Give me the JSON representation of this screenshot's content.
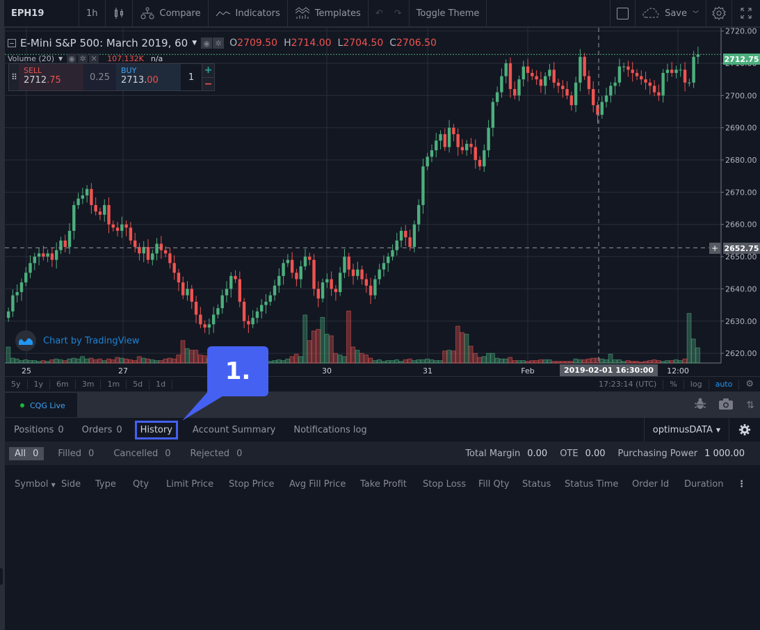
{
  "toolbar": {
    "symbol": "EPH19",
    "interval": "1h",
    "chart_type_icon": "candles-icon",
    "compare_label": "Compare",
    "indicators_label": "Indicators",
    "templates_label": "Templates",
    "toggle_theme_label": "Toggle Theme",
    "save_label": "Save"
  },
  "legend": {
    "title": "E-Mini S&P 500: March 2019, 60",
    "o_label": "O",
    "o_value": "2709.50",
    "h_label": "H",
    "h_value": "2714.00",
    "l_label": "L",
    "l_value": "2704.50",
    "c_label": "C",
    "c_value": "2706.50",
    "volume_label": "Volume (20)",
    "volume_value": "107.132K",
    "volume_ma": "n/a"
  },
  "trade_widget": {
    "sell_label": "SELL",
    "sell_price_main": "2712",
    "sell_price_hi": ".75",
    "spread": "0.25",
    "buy_label": "BUY",
    "buy_price_main": "2713.",
    "buy_price_hi": "00",
    "quantity": "1",
    "plus": "+",
    "minus": "−"
  },
  "watermark": "Chart by TradingView",
  "price_axis": {
    "last_price_tag": "2712.75",
    "crosshair_price_tag": "2652.75",
    "crosshair_time_tag": "2019-02-01 16:30:00"
  },
  "range_bar": {
    "ranges": [
      "5y",
      "1y",
      "6m",
      "3m",
      "1m",
      "5d",
      "1d"
    ],
    "clock": "17:23:14 (UTC)",
    "percent": "%",
    "log": "log",
    "auto": "auto"
  },
  "colors": {
    "up": "#4caf7d",
    "down": "#ef5350",
    "accent": "#2196f3",
    "callout": "#4461f2",
    "background": "#131722"
  },
  "chart_data": {
    "type": "candlestick",
    "title": "E-Mini S&P 500: March 2019, 60",
    "ylim": [
      2617,
      2721
    ],
    "yticks": [
      "2720.00",
      "2710.00",
      "2700.00",
      "2690.00",
      "2680.00",
      "2670.00",
      "2660.00",
      "2650.00",
      "2640.00",
      "2630.00",
      "2620.00"
    ],
    "xticks": [
      "25",
      "27",
      "30",
      "31",
      "Feb",
      "12:00"
    ],
    "grid": true,
    "last_price": 2712.75,
    "crosshair_price": 2652.75,
    "closes": [
      2633,
      2638,
      2639,
      2642,
      2645,
      2648,
      2650,
      2651,
      2650,
      2651,
      2649,
      2652,
      2655,
      2653,
      2658,
      2666,
      2668,
      2669,
      2671,
      2666,
      2664,
      2663,
      2666,
      2660,
      2659,
      2658,
      2660,
      2659,
      2655,
      2653,
      2651,
      2653,
      2649,
      2651,
      2654,
      2652,
      2651,
      2648,
      2645,
      2642,
      2638,
      2640,
      2636,
      2632,
      2629,
      2628,
      2629,
      2632,
      2634,
      2638,
      2640,
      2644,
      2643,
      2636,
      2630,
      2629,
      2631,
      2633,
      2635,
      2636,
      2638,
      2641,
      2644,
      2648,
      2649,
      2645,
      2643,
      2647,
      2650,
      2649,
      2640,
      2637,
      2642,
      2643,
      2640,
      2639,
      2645,
      2650,
      2646,
      2644,
      2646,
      2643,
      2641,
      2638,
      2643,
      2646,
      2648,
      2650,
      2652,
      2655,
      2658,
      2656,
      2653,
      2660,
      2666,
      2678,
      2681,
      2683,
      2686,
      2688,
      2684,
      2690,
      2688,
      2684,
      2683,
      2685,
      2684,
      2680,
      2678,
      2683,
      2690,
      2698,
      2701,
      2706,
      2710,
      2702,
      2700,
      2705,
      2709,
      2707,
      2706,
      2705,
      2703,
      2706,
      2708,
      2704,
      2703,
      2702,
      2700,
      2697,
      2704,
      2712,
      2706,
      2702,
      2697,
      2694,
      2698,
      2700,
      2703,
      2704,
      2709,
      2709,
      2708,
      2707,
      2706,
      2705,
      2704,
      2703,
      2701,
      2700,
      2707,
      2708,
      2707,
      2708,
      2708,
      2704,
      2704,
      2712,
      2712.75
    ],
    "volumes": [
      0.2,
      0.06,
      0.05,
      0.03,
      0.04,
      0.03,
      0.03,
      0.02,
      0.03,
      0.02,
      0.04,
      0.05,
      0.04,
      0.03,
      0.05,
      0.06,
      0.05,
      0.08,
      0.05,
      0.06,
      0.04,
      0.05,
      0.03,
      0.05,
      0.04,
      0.07,
      0.06,
      0.05,
      0.04,
      0.03,
      0.08,
      0.06,
      0.05,
      0.04,
      0.03,
      0.03,
      0.05,
      0.06,
      0.05,
      0.1,
      0.28,
      0.18,
      0.16,
      0.16,
      0.1,
      0.09,
      0.06,
      0.06,
      0.05,
      0.12,
      0.18,
      0.05,
      0.09,
      0.05,
      0.04,
      0.04,
      0.03,
      0.06,
      0.04,
      0.03,
      0.02,
      0.03,
      0.04,
      0.03,
      0.05,
      0.08,
      0.11,
      0.08,
      0.6,
      0.28,
      0.4,
      0.42,
      0.57,
      0.36,
      0.34,
      0.12,
      0.1,
      0.08,
      0.65,
      0.2,
      0.16,
      0.12,
      0.1,
      0.06,
      0.03,
      0.04,
      0.02,
      0.03,
      0.03,
      0.04,
      0.02,
      0.04,
      0.05,
      0.03,
      0.04,
      0.04,
      0.05,
      0.04,
      0.03,
      0.03,
      0.15,
      0.16,
      0.15,
      0.46,
      0.38,
      0.36,
      0.21,
      0.12,
      0.07,
      0.08,
      0.12,
      0.12,
      0.06,
      0.05,
      0.05,
      0.07,
      0.03,
      0.03,
      0.03,
      0.02,
      0.03,
      0.03,
      0.04,
      0.04,
      0.04,
      0.02,
      0.02,
      0.02,
      0.02,
      0.02,
      0.05,
      0.04,
      0.04,
      0.05,
      0.06,
      0.06,
      0.05,
      0.04,
      0.11,
      0.04,
      0.04,
      0.02,
      0.03,
      0.02,
      0.02,
      0.01,
      0.02,
      0.03,
      0.04,
      0.03,
      0.02,
      0.03,
      0.03,
      0.04,
      0.03,
      0.05,
      0.62,
      0.3,
      0.19
    ]
  },
  "panel": {
    "broker_tab": "CQG Live",
    "tabs": [
      {
        "label": "Positions",
        "count": "0"
      },
      {
        "label": "Orders",
        "count": "0"
      },
      {
        "label": "History",
        "count": ""
      },
      {
        "label": "Account Summary",
        "count": ""
      },
      {
        "label": "Notifications log",
        "count": ""
      }
    ],
    "account": "optimusDATA",
    "filters": [
      {
        "label": "All",
        "count": "0"
      },
      {
        "label": "Filled",
        "count": "0"
      },
      {
        "label": "Cancelled",
        "count": "0"
      },
      {
        "label": "Rejected",
        "count": "0"
      }
    ],
    "stats": [
      {
        "label": "Total Margin",
        "value": "0.00"
      },
      {
        "label": "OTE",
        "value": "0.00"
      },
      {
        "label": "Purchasing Power",
        "value": "1 000.00"
      }
    ],
    "columns": [
      "Symbol",
      "Side",
      "Type",
      "Qty",
      "Limit Price",
      "Stop Price",
      "Avg Fill Price",
      "Take Profit",
      "Stop Loss",
      "Fill Qty",
      "Status",
      "Status Time",
      "Order Id",
      "Duration"
    ]
  },
  "callout": {
    "label": "1."
  }
}
